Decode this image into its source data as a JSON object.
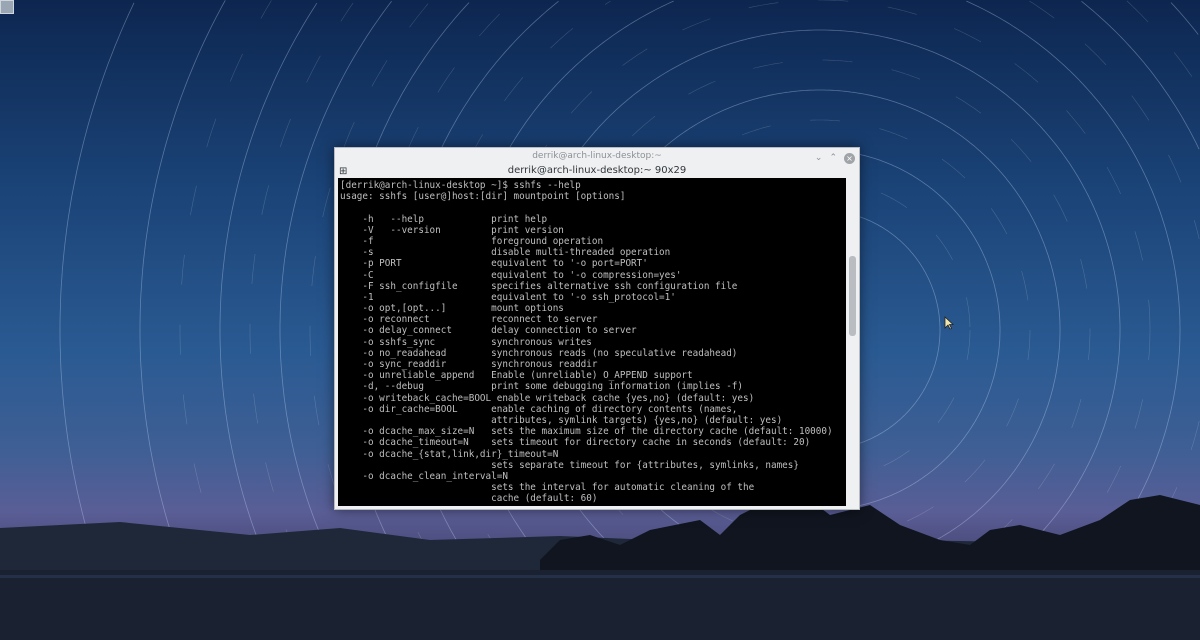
{
  "window": {
    "title": "derrik@arch-linux-desktop:~",
    "tab_title": "derrik@arch-linux-desktop:~ 90x29",
    "buttons": {
      "minimize": "⌄",
      "maximize": "⌃",
      "close": "×"
    }
  },
  "terminal": {
    "lines": [
      "[derrik@arch-linux-desktop ~]$ sshfs --help",
      "usage: sshfs [user@]host:[dir] mountpoint [options]",
      "",
      "    -h   --help            print help",
      "    -V   --version         print version",
      "    -f                     foreground operation",
      "    -s                     disable multi-threaded operation",
      "    -p PORT                equivalent to '-o port=PORT'",
      "    -C                     equivalent to '-o compression=yes'",
      "    -F ssh_configfile      specifies alternative ssh configuration file",
      "    -1                     equivalent to '-o ssh_protocol=1'",
      "    -o opt,[opt...]        mount options",
      "    -o reconnect           reconnect to server",
      "    -o delay_connect       delay connection to server",
      "    -o sshfs_sync          synchronous writes",
      "    -o no_readahead        synchronous reads (no speculative readahead)",
      "    -o sync_readdir        synchronous readdir",
      "    -o unreliable_append   Enable (unreliable) O_APPEND support",
      "    -d, --debug            print some debugging information (implies -f)",
      "    -o writeback_cache=BOOL enable writeback cache {yes,no} (default: yes)",
      "    -o dir_cache=BOOL      enable caching of directory contents (names,",
      "                           attributes, symlink targets) {yes,no} (default: yes)",
      "    -o dcache_max_size=N   sets the maximum size of the directory cache (default: 10000)",
      "    -o dcache_timeout=N    sets timeout for directory cache in seconds (default: 20)",
      "    -o dcache_{stat,link,dir}_timeout=N",
      "                           sets separate timeout for {attributes, symlinks, names}",
      "    -o dcache_clean_interval=N",
      "                           sets the interval for automatic cleaning of the",
      "                           cache (default: 60)"
    ]
  },
  "icons": {
    "tab": "split-view-icon",
    "cursor": "mouse-pointer-icon"
  }
}
